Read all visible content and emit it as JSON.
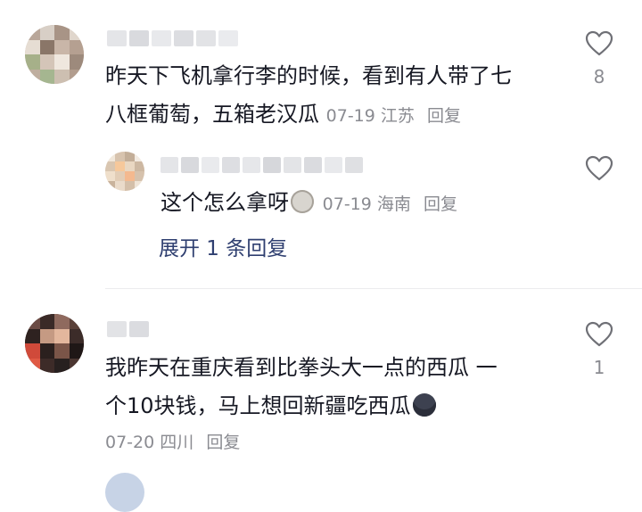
{
  "comments": [
    {
      "username": "",
      "text_line1": "昨天下飞机拿行李的时候，看到有人带了七",
      "text_line2": "八框葡萄，五箱老汉瓜",
      "date": "07-19",
      "location": "江苏",
      "reply_label": "回复",
      "likes": "8"
    },
    {
      "username": "",
      "text": "这个怎么拿呀",
      "emoji": "gourd-face-emoji",
      "date": "07-19",
      "location": "海南",
      "reply_label": "回复"
    },
    {
      "username": "",
      "text_line1": "我昨天在重庆看到比拳头大一点的西瓜 一",
      "text_line2": "个10块钱，马上想回新疆吃西瓜",
      "emoji": "sunglasses-face-emoji",
      "date": "07-20",
      "location": "四川",
      "reply_label": "回复",
      "likes": "1"
    }
  ],
  "expand_replies": "展开 1 条回复",
  "colors": {
    "text": "#161823",
    "meta": "#8a8b91",
    "link": "#2f3f70",
    "divider": "#ececee"
  }
}
